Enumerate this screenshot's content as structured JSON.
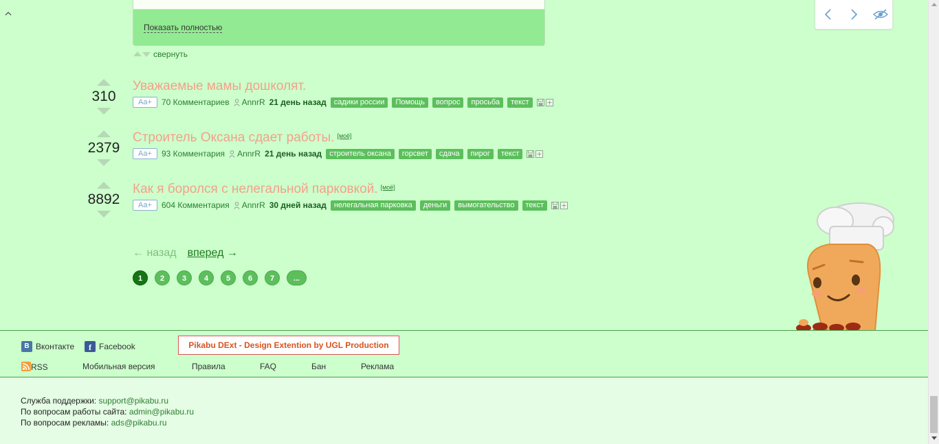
{
  "previous_post": {
    "show_full_label": "Показать полностью",
    "collapse_label": "свернуть"
  },
  "stories": [
    {
      "rating": "310",
      "title": "Уважаемые мамы дошколят.",
      "my_label": "",
      "aa_label": "Aa+",
      "comments": "70 Комментариев",
      "author": "AnnrR",
      "time": "21 день назад",
      "tags": [
        "садики россии",
        "Помощь",
        "вопрос",
        "просьба",
        "текст"
      ]
    },
    {
      "rating": "2379",
      "title": "Строитель Оксана сдает работы.",
      "my_label": "[моё]",
      "aa_label": "Aa+",
      "comments": "93 Комментария",
      "author": "AnnrR",
      "time": "21 день назад",
      "tags": [
        "строитель оксана",
        "горсвет",
        "сдача",
        "пирог",
        "текст"
      ]
    },
    {
      "rating": "8892",
      "title": "Как я боролся с нелегальной парковкой.",
      "my_label": "[моё]",
      "aa_label": "Aa+",
      "comments": "604 Комментария",
      "author": "AnnrR",
      "time": "30 дней назад",
      "tags": [
        "нелегальная парковка",
        "деньги",
        "вымогательство",
        "текст"
      ]
    }
  ],
  "pagination": {
    "prev_label": "← назад",
    "next_word": "вперед",
    "next_arrow": "→",
    "pages": [
      "1",
      "2",
      "3",
      "4",
      "5",
      "6",
      "7",
      "..."
    ],
    "current_page": "1"
  },
  "footer": {
    "vk_label": "Вконтакте",
    "vk_icon_text": "B",
    "fb_label": "Facebook",
    "fb_icon_text": "f",
    "dext_banner": "Pikabu DExt - Design Extention by UGL Production",
    "links": {
      "rss": "RSS",
      "mobile": "Мобильная версия",
      "rules": "Правила",
      "faq": "FAQ",
      "ban": "Бан",
      "ads": "Реклама"
    },
    "contacts": [
      {
        "label": "Служба поддержки: ",
        "email": "support@pikabu.ru"
      },
      {
        "label": "По вопросам работы сайта: ",
        "email": "admin@pikabu.ru"
      },
      {
        "label": "По вопросам рекламы: ",
        "email": "ads@pikabu.ru"
      }
    ]
  },
  "icons": {
    "collapse": "chevron-up-icon",
    "nav_prev": "chevron-left-icon",
    "nav_next": "chevron-right-icon",
    "nav_hide": "eye-slash-icon",
    "author": "user-icon",
    "save": "save-icon",
    "add": "plus-icon"
  },
  "colors": {
    "background": "#ccffcc",
    "title": "#f4a08a",
    "tag": "#5cbf5c",
    "link": "#2e7d32",
    "banner": "#d9531e"
  }
}
